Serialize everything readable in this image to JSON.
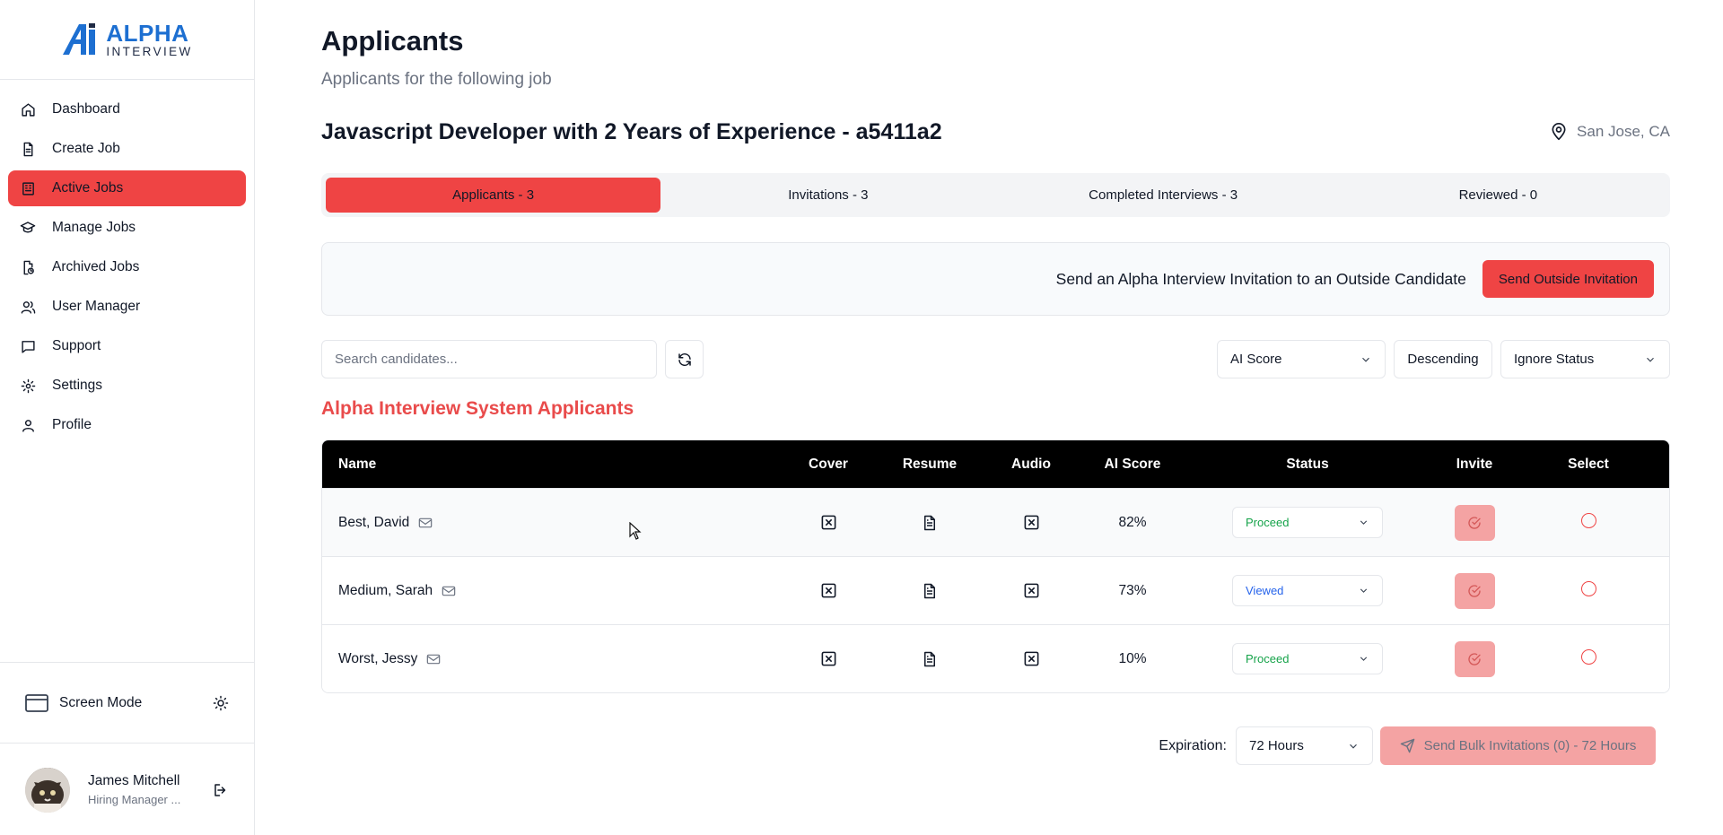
{
  "brand": {
    "line1": "ALPHA",
    "line2": "INTERVIEW"
  },
  "sidebar": {
    "items": [
      {
        "label": "Dashboard",
        "icon": "home-icon"
      },
      {
        "label": "Create Job",
        "icon": "file-icon"
      },
      {
        "label": "Active Jobs",
        "icon": "building-icon"
      },
      {
        "label": "Manage Jobs",
        "icon": "graduation-cap-icon"
      },
      {
        "label": "Archived Jobs",
        "icon": "archive-icon"
      },
      {
        "label": "User Manager",
        "icon": "users-icon"
      },
      {
        "label": "Support",
        "icon": "message-icon"
      },
      {
        "label": "Settings",
        "icon": "gear-icon"
      },
      {
        "label": "Profile",
        "icon": "user-icon"
      }
    ],
    "active_index": 2,
    "screen_mode_label": "Screen Mode",
    "user": {
      "name": "James Mitchell",
      "role": "Hiring Manager ..."
    }
  },
  "page": {
    "title": "Applicants",
    "subtitle": "Applicants for the following job",
    "job_title": "Javascript Developer with 2 Years of Experience - a5411a2",
    "location": "San Jose, CA"
  },
  "tabs": [
    {
      "label": "Applicants - 3",
      "active": true
    },
    {
      "label": "Invitations - 3",
      "active": false
    },
    {
      "label": "Completed Interviews - 3",
      "active": false
    },
    {
      "label": "Reviewed - 0",
      "active": false
    }
  ],
  "invite_box": {
    "text": "Send an Alpha Interview Invitation to an Outside Candidate",
    "button": "Send Outside Invitation"
  },
  "filters": {
    "search_placeholder": "Search candidates...",
    "sort_field": "AI Score",
    "sort_order": "Descending",
    "status_filter": "Ignore Status"
  },
  "section_title": "Alpha Interview System Applicants",
  "table": {
    "headers": [
      "Name",
      "Cover",
      "Resume",
      "Audio",
      "AI Score",
      "Status",
      "Invite",
      "Select"
    ],
    "rows": [
      {
        "name": "Best, David",
        "score": "82%",
        "status": "Proceed"
      },
      {
        "name": "Medium, Sarah",
        "score": "73%",
        "status": "Viewed"
      },
      {
        "name": "Worst, Jessy",
        "score": "10%",
        "status": "Proceed"
      }
    ]
  },
  "footer": {
    "expiration_label": "Expiration:",
    "expiration_value": "72 Hours",
    "bulk_button": "Send Bulk Invitations (0) - 72 Hours"
  },
  "colors": {
    "accent": "#ef4444",
    "accent_light": "#f4a3a3",
    "brand_blue": "#1d6fd1",
    "proceed": "#16a34a",
    "viewed": "#2563eb"
  }
}
